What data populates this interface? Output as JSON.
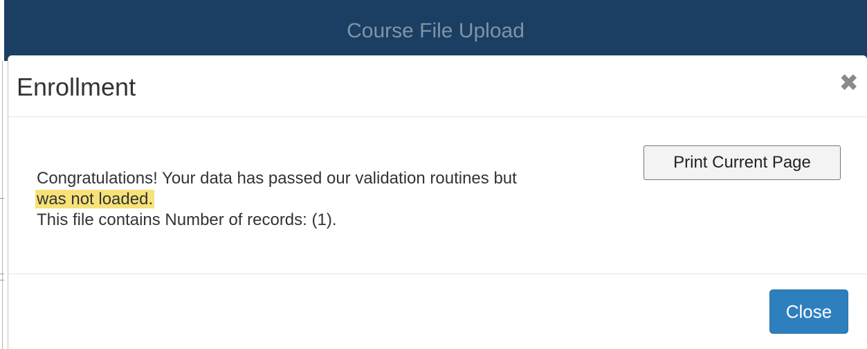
{
  "background": {
    "header_title": "Course File Upload",
    "header_color": "#1a3f62"
  },
  "modal": {
    "title": "Enrollment",
    "close_icon": "close-x-icon",
    "print_label": "Print Current Page",
    "message": {
      "line1": "Congratulations! Your data has passed our validation routines but",
      "line2_highlighted": "was not loaded.",
      "line3": "This file contains Number of records: (1)."
    },
    "highlight_color": "#f7e27a",
    "close_label": "Close",
    "close_button_color": "#2e7fbe"
  }
}
